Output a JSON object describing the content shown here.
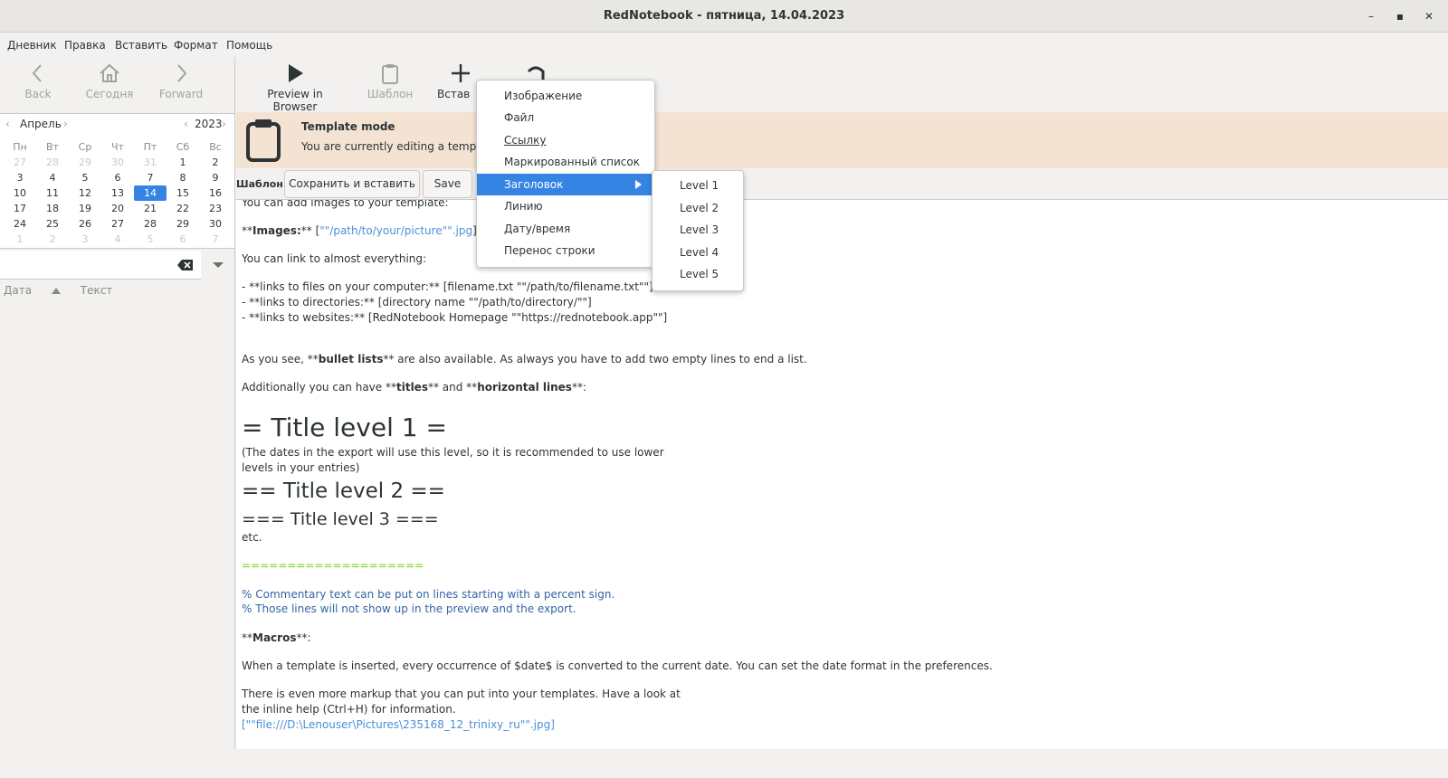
{
  "window": {
    "title": "RedNotebook - пятница, 14.04.2023"
  },
  "menu": [
    "Дневник",
    "Правка",
    "Вставить",
    "Формат",
    "Помощь"
  ],
  "nav": {
    "back": "Back",
    "today": "Сегодня",
    "forward": "Forward"
  },
  "calendar": {
    "month": "Апрель",
    "year": "2023",
    "weekdays": [
      "Пн",
      "Вт",
      "Ср",
      "Чт",
      "Пт",
      "Сб",
      "Вс"
    ],
    "weeks": [
      [
        "27",
        "28",
        "29",
        "30",
        "31",
        "1",
        "2"
      ],
      [
        "3",
        "4",
        "5",
        "6",
        "7",
        "8",
        "9"
      ],
      [
        "10",
        "11",
        "12",
        "13",
        "14",
        "15",
        "16"
      ],
      [
        "17",
        "18",
        "19",
        "20",
        "21",
        "22",
        "23"
      ],
      [
        "24",
        "25",
        "26",
        "27",
        "28",
        "29",
        "30"
      ],
      [
        "1",
        "2",
        "3",
        "4",
        "5",
        "6",
        "7"
      ]
    ],
    "selected": "14"
  },
  "list_columns": {
    "date": "Дата",
    "text": "Текст"
  },
  "toolbar": {
    "preview": "Preview in Browser",
    "template": "Шаблон",
    "insert": "Встав"
  },
  "infobar": {
    "title": "Template mode",
    "message": "You are currently editing a template."
  },
  "template_bar": {
    "label": "Шаблон:",
    "save_insert": "Сохранить и вставить",
    "save": "Save"
  },
  "editor": {
    "lines": [
      {
        "text": "You can add images to your template:"
      },
      {
        "pre": "**",
        "bold": "Images:",
        "post": "** [",
        "link": "\"\"/path/to/your/picture\"\".jpg",
        "tail": "]"
      },
      {
        "text": "You can link to almost everything:"
      },
      {
        "text": "- **links to files on your computer:** [filename.txt \"\"/path/to/filename.txt\"\"]"
      },
      {
        "text": "- **links to directories:** [directory name \"\"/path/to/directory/\"\"]"
      },
      {
        "text": "- **links to websites:** [RedNotebook Homepage \"\"https://rednotebook.app\"\"]"
      },
      {
        "pre": "As you see, **",
        "bold": "bullet lists",
        "post": "** are also available. As always you have to add two empty lines to end a list."
      },
      {
        "pre": "Additionally you can have **",
        "bold": "titles",
        "post": "** and **",
        "bold2": "horizontal lines",
        "post2": "**:"
      },
      {
        "text": "= Title level 1 ="
      },
      {
        "text": "(The dates in the export will use this level, so it is recommended to use lower"
      },
      {
        "text": "levels in your entries)"
      },
      {
        "text": "== Title level 2 =="
      },
      {
        "text": "=== Title level 3 ==="
      },
      {
        "text": "etc."
      },
      {
        "text": "===================="
      },
      {
        "text": "% Commentary text can be put on lines starting with a percent sign."
      },
      {
        "text": "% Those lines will not show up in the preview and the export."
      },
      {
        "pre": "**",
        "bold": "Macros",
        "post": "**:"
      },
      {
        "text": "When a template is inserted, every occurrence of $date$ is converted to the current date. You can set the date format in the preferences."
      },
      {
        "text": "There is even more markup that you can put into your templates. Have a look at"
      },
      {
        "text": "the inline help (Ctrl+H) for information."
      },
      {
        "link": "[\"\"file:///D:\\Lenouser\\Pictures\\235168_12_trinixy_ru\"\".jpg]"
      }
    ]
  },
  "insert_menu": {
    "items": [
      "Изображение",
      "Файл",
      "Ссылку",
      "Маркированный список",
      "Заголовок",
      "Линию",
      "Дату/время",
      "Перенос строки"
    ],
    "active": "Заголовок"
  },
  "heading_submenu": {
    "items": [
      "Level 1",
      "Level 2",
      "Level 3",
      "Level 4",
      "Level 5"
    ]
  },
  "colors": {
    "accent": "#3584e4",
    "infobar": "#f4e3d3",
    "link": "#4a90d9",
    "hr": "#73d216",
    "comment": "#3465a4"
  }
}
